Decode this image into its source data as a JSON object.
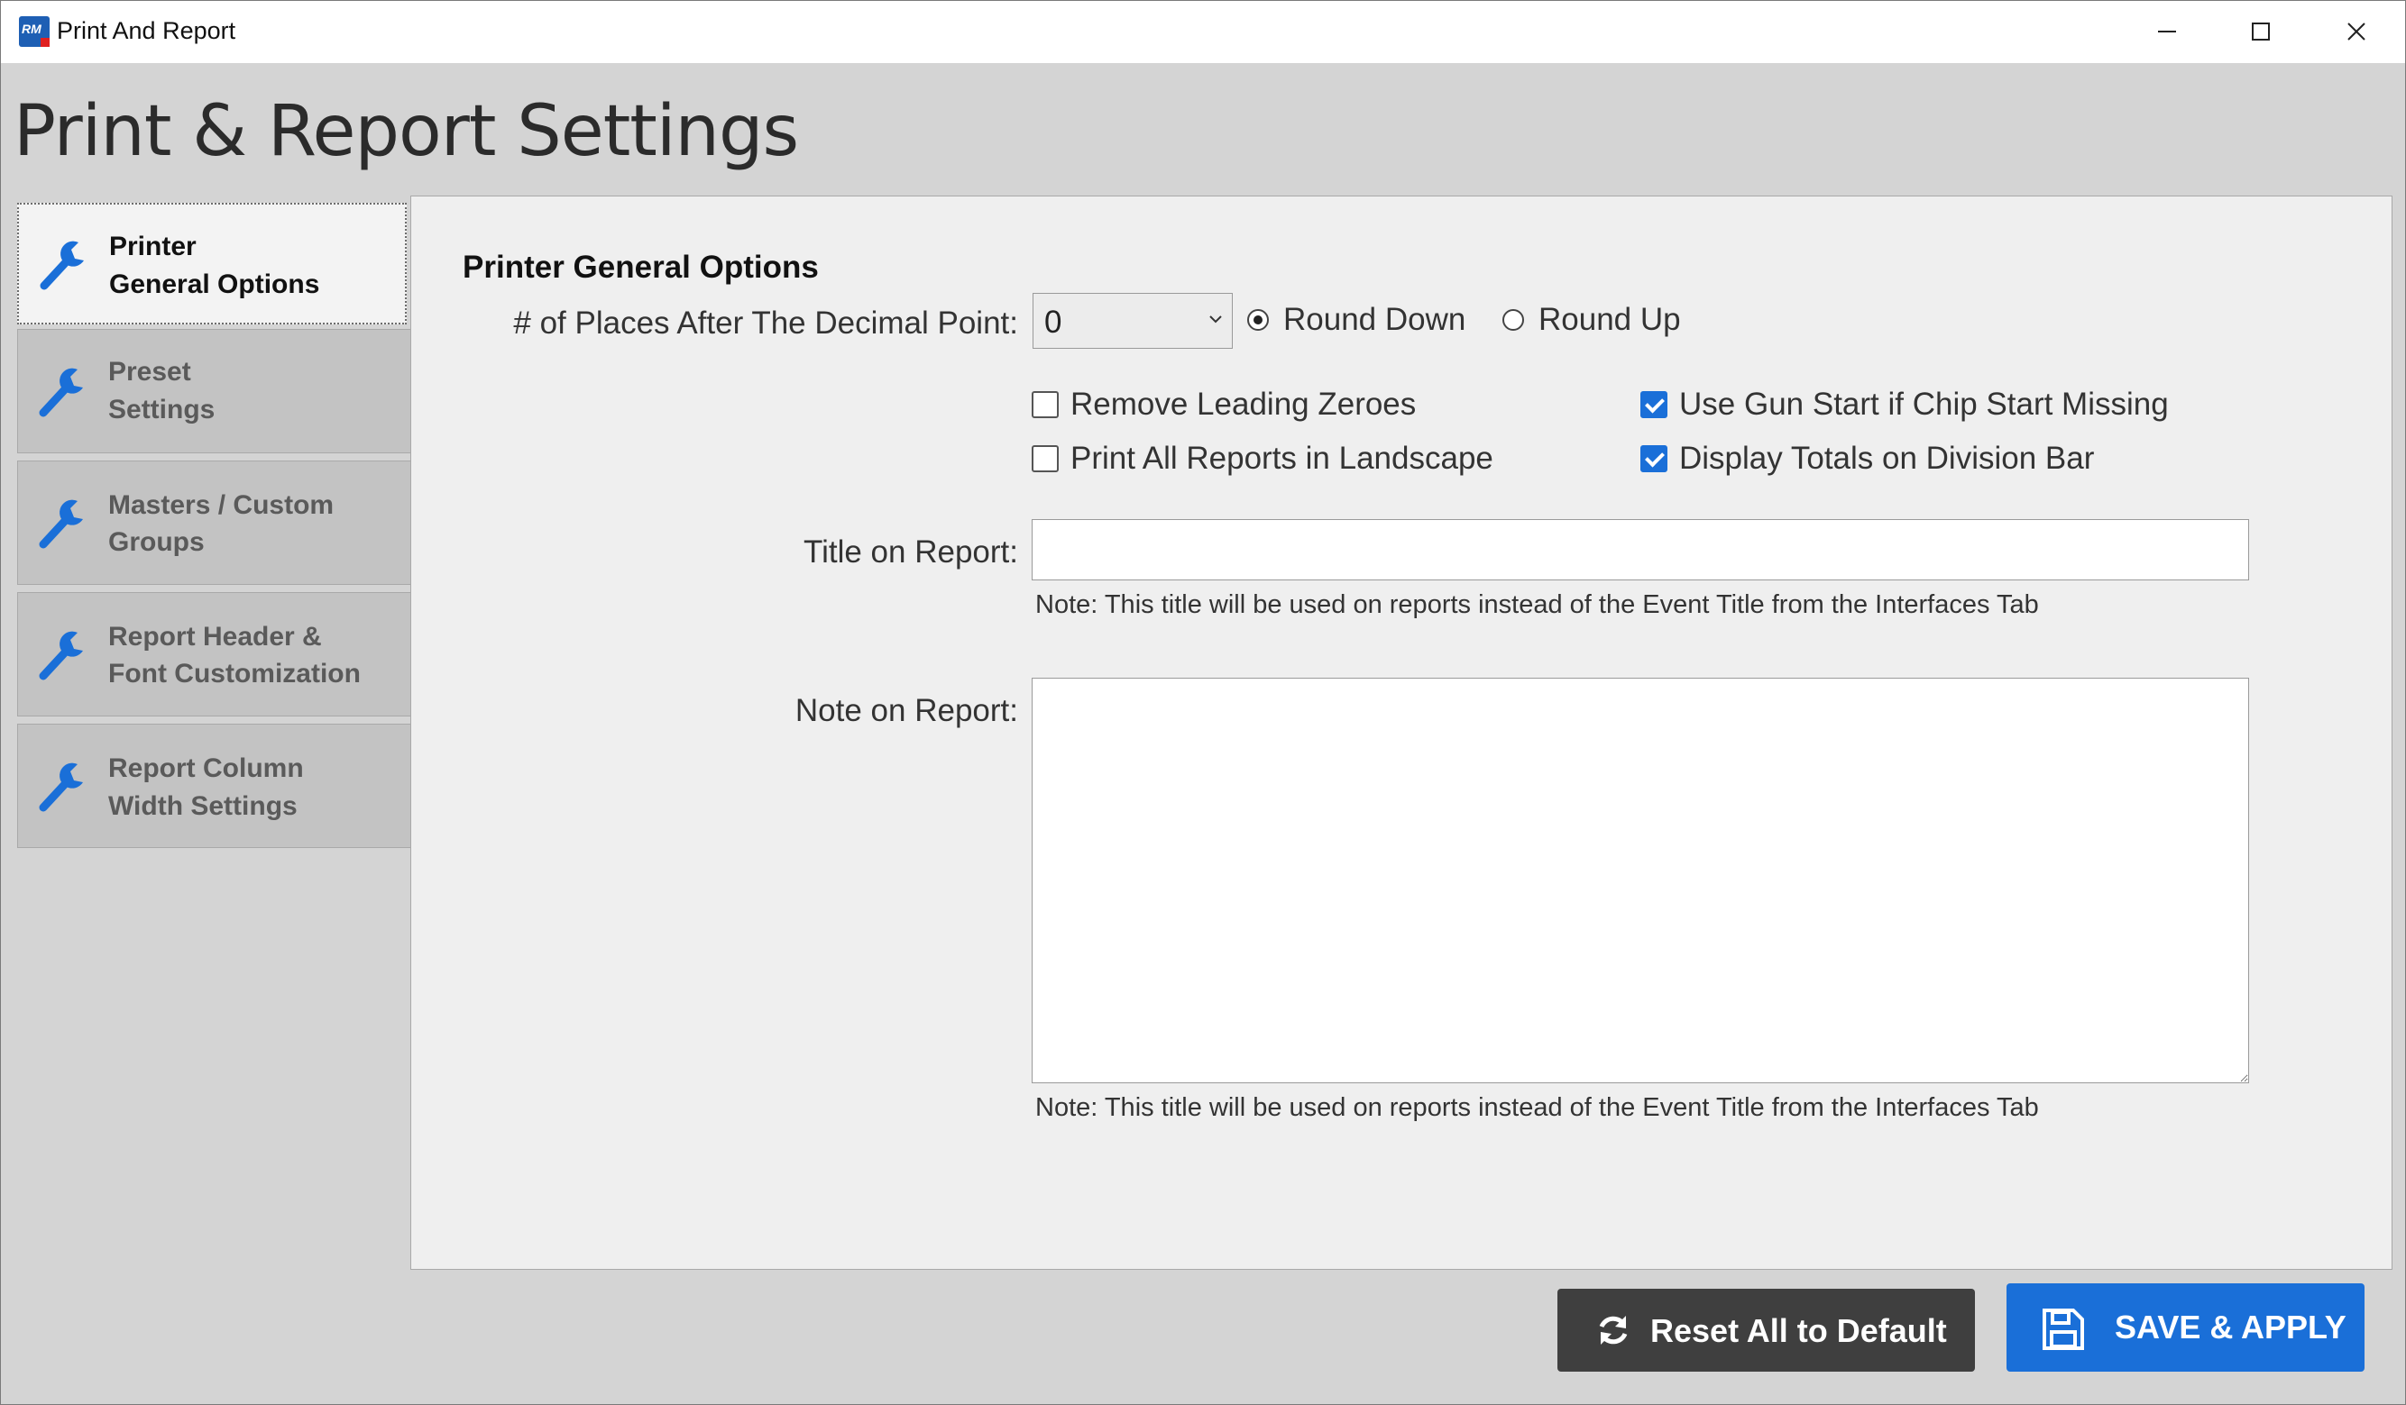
{
  "window": {
    "title": "Print And Report",
    "app_icon": "rm-app-icon",
    "controls": [
      "minimize-icon",
      "maximize-icon",
      "close-icon"
    ]
  },
  "page": {
    "title": "Print & Report Settings"
  },
  "sidebar": {
    "items": [
      {
        "line1": "Printer",
        "line2": "General Options",
        "icon": "wrench-icon",
        "active": true
      },
      {
        "line1": "Preset",
        "line2": "Settings",
        "icon": "wrench-icon",
        "active": false
      },
      {
        "line1": "Masters / Custom",
        "line2": "Groups",
        "icon": "wrench-icon",
        "active": false
      },
      {
        "line1": "Report Header &",
        "line2": "Font Customization",
        "icon": "wrench-icon",
        "active": false
      },
      {
        "line1": "Report Column",
        "line2": "Width Settings",
        "icon": "wrench-icon",
        "active": false
      }
    ]
  },
  "main": {
    "section_title": "Printer General Options",
    "decimal": {
      "label": "# of Places After The Decimal Point:",
      "selected": "0",
      "round_down": {
        "label": "Round Down",
        "selected": true
      },
      "round_up": {
        "label": "Round Up",
        "selected": false
      }
    },
    "checkboxes": {
      "remove_leading_zeroes": {
        "label": "Remove Leading Zeroes",
        "checked": false
      },
      "print_landscape": {
        "label": "Print All Reports in Landscape",
        "checked": false
      },
      "gun_start": {
        "label": "Use Gun Start if Chip Start Missing",
        "checked": true
      },
      "display_totals": {
        "label": "Display Totals on Division Bar",
        "checked": true
      }
    },
    "title_on_report": {
      "label": "Title on Report:",
      "value": "",
      "note": "Note: This title will be used on reports instead of the Event Title from the Interfaces Tab"
    },
    "note_on_report": {
      "label": "Note on Report:",
      "value": "",
      "note": "Note: This title will be used on reports instead of the Event Title from the Interfaces Tab"
    }
  },
  "footer": {
    "reset_label": "Reset All to Default",
    "save_label": "SAVE & APPLY"
  },
  "colors": {
    "accent": "#1a6fd8",
    "reset_button": "#3f3f3f"
  }
}
